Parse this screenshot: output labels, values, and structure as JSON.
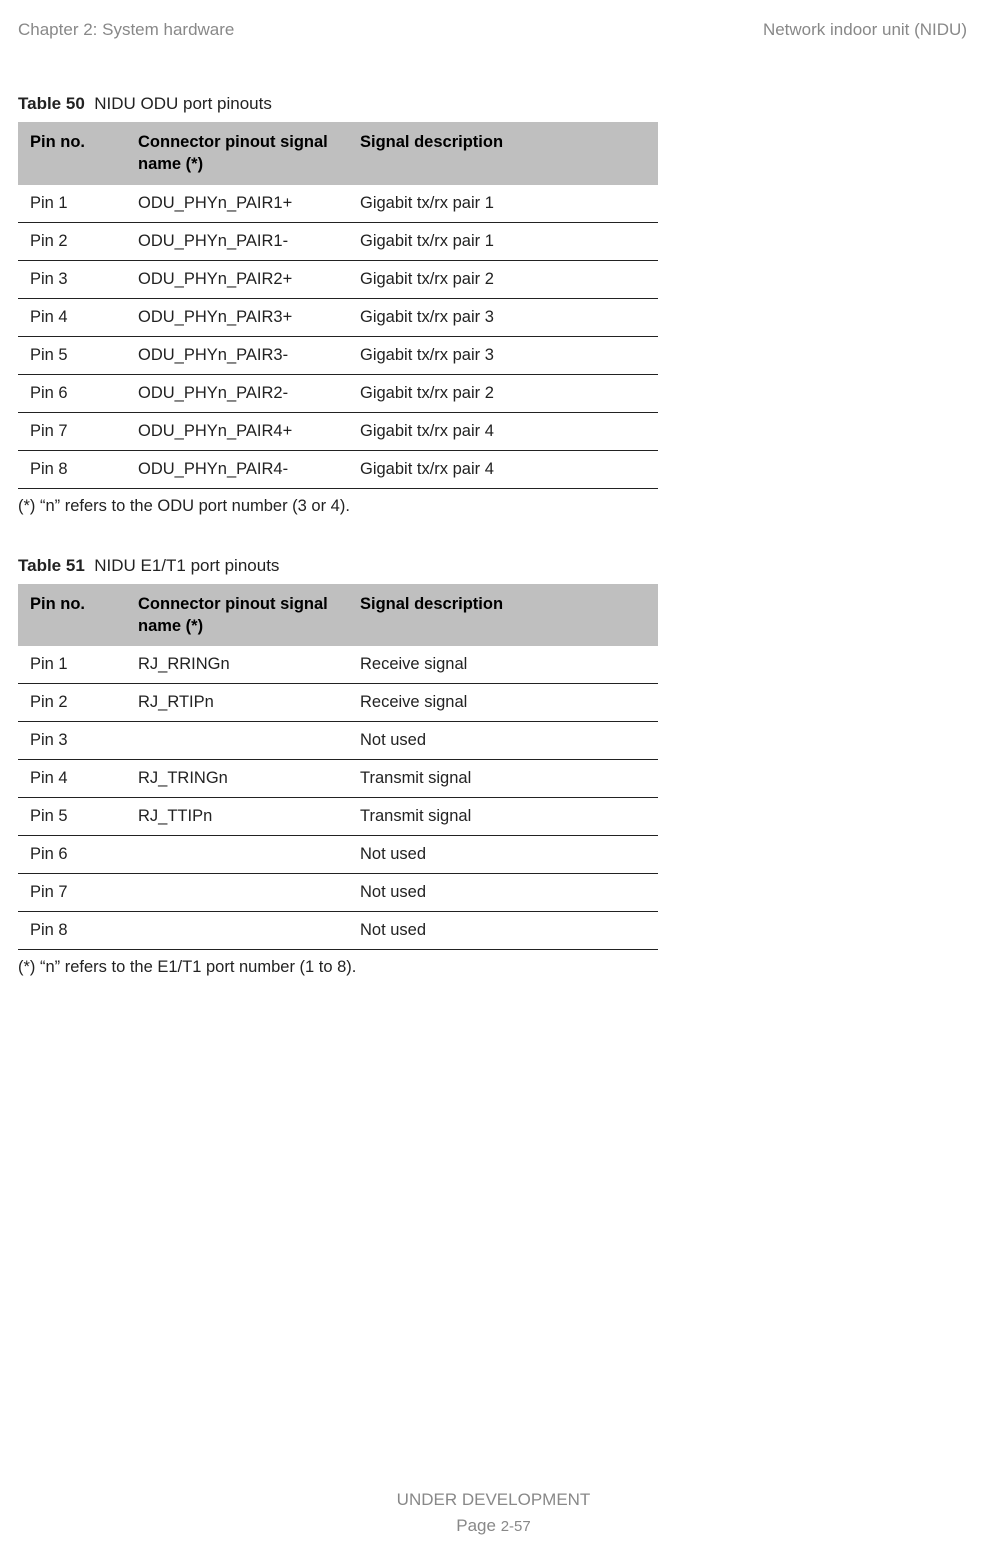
{
  "header": {
    "left": "Chapter 2:  System hardware",
    "right": "Network indoor unit (NIDU)"
  },
  "table50": {
    "label": "Table 50",
    "title": "NIDU ODU port pinouts",
    "headers": {
      "pin": "Pin no.",
      "conn": "Connector pinout signal name (*)",
      "sig": "Signal description"
    },
    "rows": [
      {
        "pin": "Pin 1",
        "conn": "ODU_PHYn_PAIR1+",
        "sig": "Gigabit tx/rx pair 1"
      },
      {
        "pin": "Pin 2",
        "conn": "ODU_PHYn_PAIR1-",
        "sig": "Gigabit tx/rx pair 1"
      },
      {
        "pin": "Pin 3",
        "conn": "ODU_PHYn_PAIR2+",
        "sig": "Gigabit tx/rx pair 2"
      },
      {
        "pin": "Pin 4",
        "conn": "ODU_PHYn_PAIR3+",
        "sig": "Gigabit tx/rx pair 3"
      },
      {
        "pin": "Pin 5",
        "conn": "ODU_PHYn_PAIR3-",
        "sig": "Gigabit tx/rx pair 3"
      },
      {
        "pin": "Pin 6",
        "conn": "ODU_PHYn_PAIR2-",
        "sig": "Gigabit tx/rx pair 2"
      },
      {
        "pin": "Pin 7",
        "conn": "ODU_PHYn_PAIR4+",
        "sig": "Gigabit tx/rx pair 4"
      },
      {
        "pin": "Pin 8",
        "conn": "ODU_PHYn_PAIR4-",
        "sig": "Gigabit tx/rx pair 4"
      }
    ],
    "footnote": "(*) “n” refers to the ODU port number (3 or 4)."
  },
  "table51": {
    "label": "Table 51",
    "title": "NIDU E1/T1 port pinouts",
    "headers": {
      "pin": "Pin no.",
      "conn": "Connector pinout signal name (*)",
      "sig": "Signal description"
    },
    "rows": [
      {
        "pin": "Pin 1",
        "conn": "RJ_RRINGn",
        "sig": "Receive signal"
      },
      {
        "pin": "Pin 2",
        "conn": "RJ_RTIPn",
        "sig": "Receive signal"
      },
      {
        "pin": "Pin 3",
        "conn": "",
        "sig": "Not used"
      },
      {
        "pin": "Pin 4",
        "conn": "RJ_TRINGn",
        "sig": "Transmit signal"
      },
      {
        "pin": "Pin 5",
        "conn": "RJ_TTIPn",
        "sig": "Transmit signal"
      },
      {
        "pin": "Pin 6",
        "conn": "",
        "sig": "Not used"
      },
      {
        "pin": "Pin 7",
        "conn": "",
        "sig": "Not used"
      },
      {
        "pin": "Pin 8",
        "conn": "",
        "sig": "Not used"
      }
    ],
    "footnote": "(*) “n” refers to the E1/T1 port number (1 to 8)."
  },
  "footer": {
    "line1": "UNDER DEVELOPMENT",
    "line2_prefix": "Page ",
    "line2_page": "2-57"
  }
}
